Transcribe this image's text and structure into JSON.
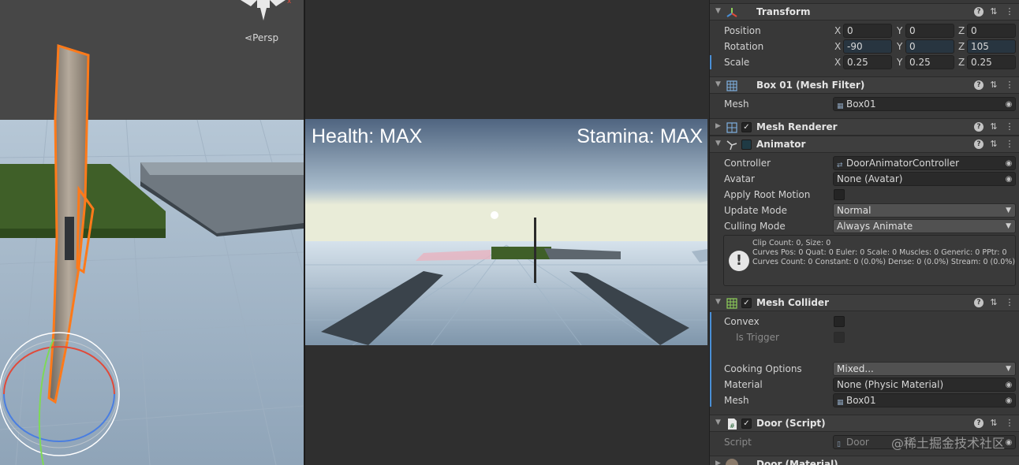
{
  "scene_view": {
    "persp_label": "Persp"
  },
  "game_view": {
    "health_text": "Health: MAX",
    "stamina_text": "Stamina: MAX"
  },
  "inspector": {
    "transform": {
      "title": "Transform",
      "position": {
        "label": "Position",
        "x": "0",
        "y": "0",
        "z": "0"
      },
      "rotation": {
        "label": "Rotation",
        "x": "-90",
        "y": "0",
        "z": "105"
      },
      "scale": {
        "label": "Scale",
        "x": "0.25",
        "y": "0.25",
        "z": "0.25"
      },
      "axis_x": "X",
      "axis_y": "Y",
      "axis_z": "Z"
    },
    "mesh_filter": {
      "title": "Box 01 (Mesh Filter)",
      "mesh_label": "Mesh",
      "mesh_value": "Box01"
    },
    "mesh_renderer": {
      "title": "Mesh Renderer"
    },
    "animator": {
      "title": "Animator",
      "controller_label": "Controller",
      "controller_value": "DoorAnimatorController",
      "avatar_label": "Avatar",
      "avatar_value": "None (Avatar)",
      "apply_root_motion_label": "Apply Root Motion",
      "update_mode_label": "Update Mode",
      "update_mode_value": "Normal",
      "culling_mode_label": "Culling Mode",
      "culling_mode_value": "Always Animate",
      "info_line1": "Clip Count: 0, Size: 0",
      "info_line2": "Curves Pos: 0 Quat: 0 Euler: 0 Scale: 0 Muscles: 0 Generic: 0 PPtr: 0",
      "info_line3": "Curves Count: 0 Constant: 0 (0.0%) Dense: 0 (0.0%) Stream: 0 (0.0%)"
    },
    "mesh_collider": {
      "title": "Mesh Collider",
      "convex_label": "Convex",
      "is_trigger_label": "Is Trigger",
      "cooking_options_label": "Cooking Options",
      "cooking_options_value": "Mixed...",
      "material_label": "Material",
      "material_value": "None (Physic Material)",
      "mesh_label": "Mesh",
      "mesh_value": "Box01"
    },
    "door_script": {
      "title": "Door (Script)",
      "script_label": "Script",
      "script_value": "Door"
    },
    "next_component_title": "Door (Material)"
  },
  "watermark": "@稀土掘金技术社区",
  "colors": {
    "selection_outline": "#ff7a1a",
    "inspector_bg": "#383838",
    "accent_blue": "#4a8fd6"
  }
}
